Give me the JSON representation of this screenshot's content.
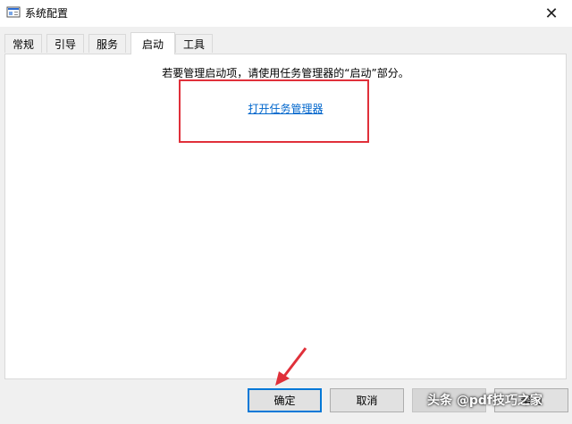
{
  "window": {
    "title": "系统配置",
    "close_glyph": "✕"
  },
  "tabs": [
    {
      "label": "常规",
      "active": false
    },
    {
      "label": "引导",
      "active": false
    },
    {
      "label": "服务",
      "active": false
    },
    {
      "label": "启动",
      "active": true
    },
    {
      "label": "工具",
      "active": false
    }
  ],
  "startup": {
    "description": "若要管理启动项，请使用任务管理器的“启动”部分。",
    "link": "打开任务管理器"
  },
  "buttons": {
    "ok": "确定",
    "cancel": "取消",
    "apply": "",
    "help": "帮助"
  },
  "annotations": {
    "highlight_color": "#e0303a"
  },
  "watermark": "头条 @pdf技巧之家",
  "colors": {
    "link": "#0066cc",
    "default_button_border": "#0078d7"
  }
}
